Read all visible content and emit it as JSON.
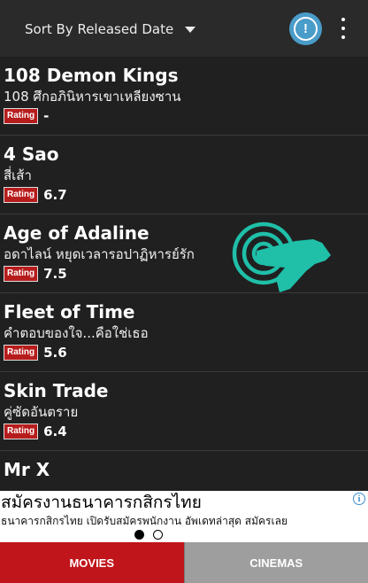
{
  "toolbar": {
    "sort_label": "Sort By Released Date",
    "info_icon": "info-circle-icon",
    "info_glyph": "!",
    "more_icon": "more-vertical-icon"
  },
  "rating_badge_text": "Rating",
  "movies": [
    {
      "title": "108 Demon Kings",
      "thai": "108 ศึกอภินิหารเขาเหลียงซาน",
      "rating": "-"
    },
    {
      "title": "4 Sao",
      "thai": "สี่เส้า",
      "rating": "6.7"
    },
    {
      "title": "Age of Adaline",
      "thai": "อดาไลน์ หยุดเวลารอปาฏิหารย์รัก",
      "rating": "7.5"
    },
    {
      "title": "Fleet of Time",
      "thai": "คำตอบของใจ...คือใช่เธอ",
      "rating": "5.6"
    },
    {
      "title": "Skin Trade",
      "thai": "คู่ซัดอันตราย",
      "rating": "6.4"
    },
    {
      "title": "Mr X",
      "thai": "",
      "rating": ""
    }
  ],
  "overlay": {
    "icon": "tap-gesture-icon",
    "color": "#1fbfa8"
  },
  "ad": {
    "title": "สมัครงานธนาคารกสิกรไทย",
    "subtitle": "ธนาคารกสิกรไทย เปิดรับสมัครพนักงาน อัพเดทล่าสุด สมัครเลย",
    "info_glyph": "i",
    "page_indicator": {
      "active": 1,
      "count": 2
    }
  },
  "tabs": {
    "movies": "MOVIES",
    "cinemas": "CINEMAS",
    "active": "movies"
  },
  "colors": {
    "accent_red": "#c0151b",
    "info_blue": "#4a9cc9",
    "tab_inactive": "#9e9e9e"
  }
}
